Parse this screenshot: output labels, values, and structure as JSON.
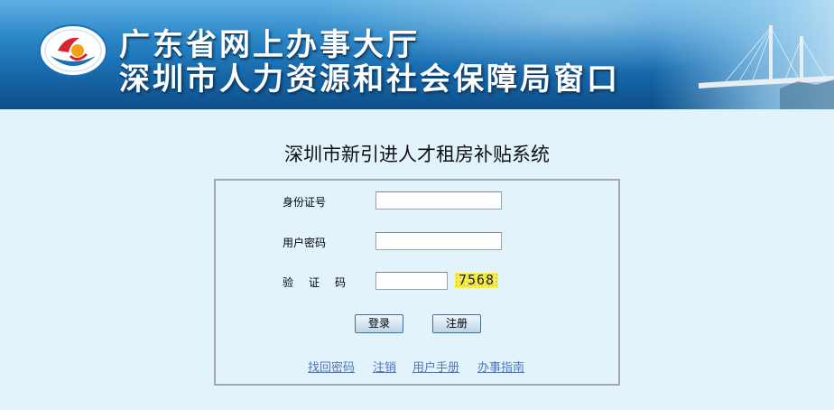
{
  "header": {
    "title_line1": "广东省网上办事大厅",
    "title_line2": "深圳市人力资源和社会保障局窗口"
  },
  "system_title": "深圳市新引进人才租房补贴系统",
  "form": {
    "id_label": "身份证号",
    "id_value": "",
    "password_label": "用户密码",
    "password_value": "",
    "captcha_label": [
      "验",
      "证",
      "码"
    ],
    "captcha_value": "",
    "captcha_code": "7568"
  },
  "buttons": {
    "login": "登录",
    "register": "注册"
  },
  "links": {
    "recover_password": "找回密码",
    "cancel": "注销",
    "user_manual": "用户手册",
    "guide": "办事指南"
  },
  "colors": {
    "background": "#e2f3fc",
    "banner": "#1566a8",
    "link": "#5177b8",
    "captcha_bg": "#f7ef4a",
    "box_border": "#a5a8ab"
  }
}
